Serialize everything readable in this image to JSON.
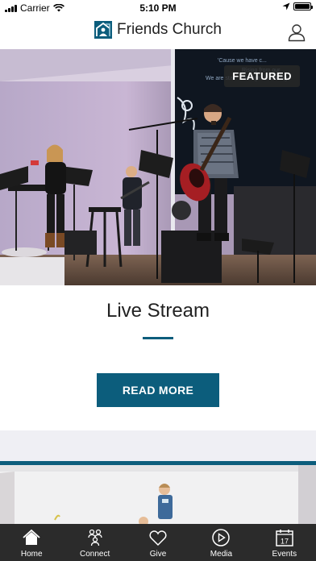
{
  "status_bar": {
    "carrier": "Carrier",
    "time": "5:10 PM"
  },
  "header": {
    "title": "Friends Church"
  },
  "featured_card": {
    "badge": "FEATURED",
    "title": "Live Stream",
    "button_label": "READ MORE"
  },
  "tabs": [
    {
      "label": "Home",
      "icon": "home-icon"
    },
    {
      "label": "Connect",
      "icon": "connect-icon"
    },
    {
      "label": "Give",
      "icon": "heart-icon"
    },
    {
      "label": "Media",
      "icon": "play-icon"
    },
    {
      "label": "Events",
      "icon": "calendar-icon",
      "calendar_day": "17"
    }
  ],
  "colors": {
    "accent": "#0c5d7c",
    "tabbar": "#2b2b2b"
  }
}
